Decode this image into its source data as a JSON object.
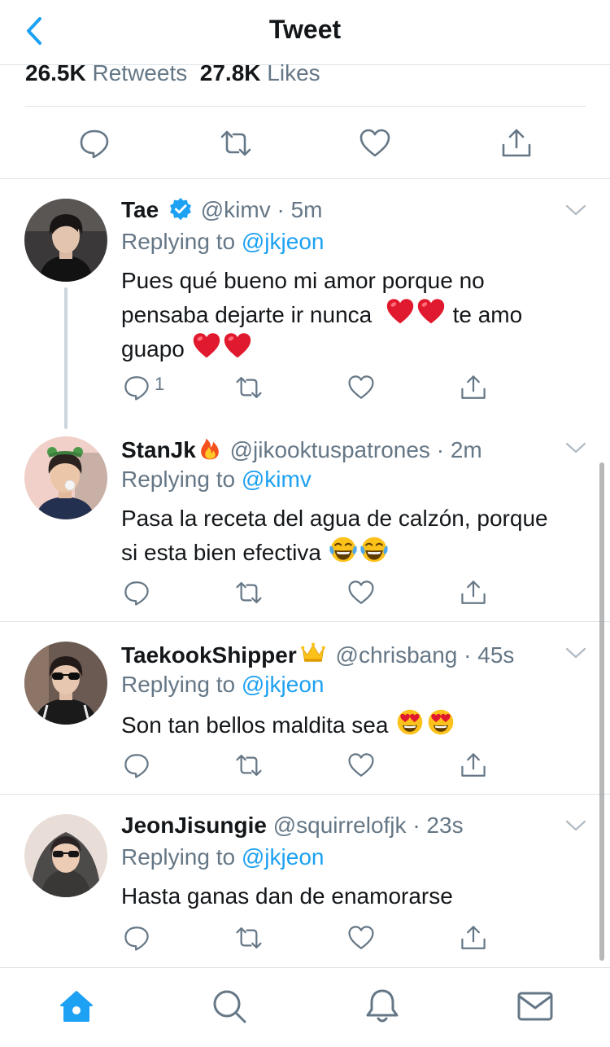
{
  "header": {
    "title": "Tweet"
  },
  "stats": {
    "retweets_count": "26.5K",
    "retweets_label": "Retweets",
    "likes_count": "27.8K",
    "likes_label": "Likes"
  },
  "replies": [
    {
      "name": "Tae",
      "verified": true,
      "handle": "@kimv",
      "time": "5m",
      "replying_to_label": "Replying to",
      "replying_to": "@jkjeon",
      "text_line1": "Pues qué bueno mi amor porque no",
      "text_line2a": "pensaba dejarte ir nunca",
      "text_line2b": "te amo",
      "text_line3": "guapo",
      "reply_count": "1"
    },
    {
      "name": "StanJk",
      "handle": "@jikooktuspatrones",
      "time": "2m",
      "replying_to_label": "Replying to",
      "replying_to": "@kimv",
      "text_line1": "Pasa la receta del agua de calzón, porque",
      "text_line2": "si esta bien efectiva"
    },
    {
      "name": "TaekookShipper",
      "handle": "@chrisbang",
      "time": "45s",
      "replying_to_label": "Replying to",
      "replying_to": "@jkjeon",
      "text_line1": "Son tan bellos maldita sea"
    },
    {
      "name": "JeonJisungie",
      "handle": "@squirrelofjk",
      "time": "23s",
      "replying_to_label": "Replying to",
      "replying_to": "@jkjeon",
      "text_line1": "Hasta ganas dan de enamorarse"
    }
  ],
  "separator": "·",
  "emojis": {
    "heart": "red-heart",
    "fire": "fire",
    "laugh": "tears-of-joy",
    "love": "heart-eyes",
    "crown": "crown"
  },
  "colors": {
    "accent": "#1da1f2",
    "secondary_text": "#657786",
    "primary_text": "#14171a",
    "divider": "#dfe3e6",
    "heart_red": "#e0192e"
  },
  "tabbar": {
    "active_tab": "home",
    "tabs": [
      "home",
      "search",
      "notifications",
      "messages"
    ]
  }
}
